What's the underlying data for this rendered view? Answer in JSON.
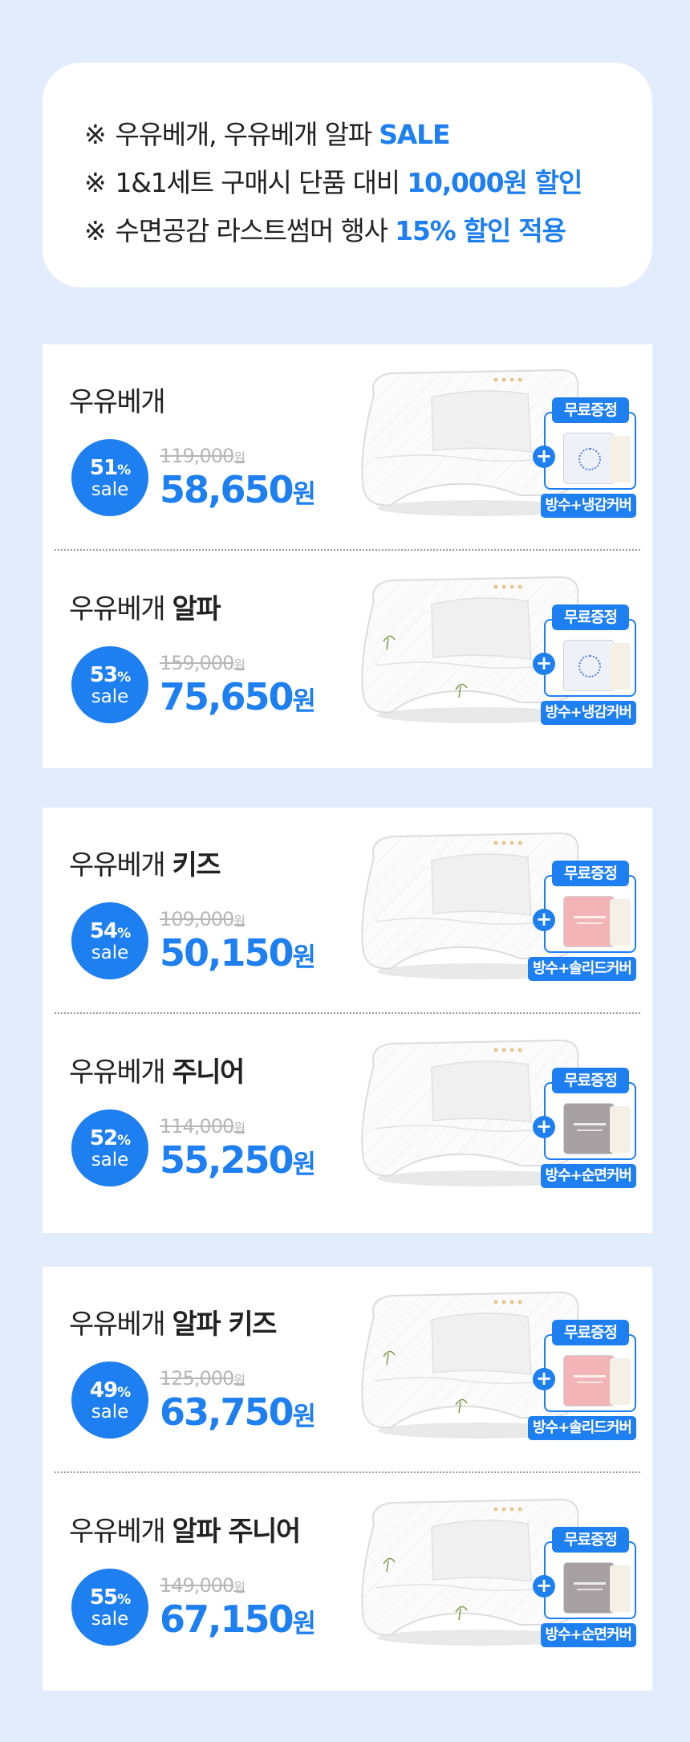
{
  "notice": {
    "mark": "※",
    "lines": [
      {
        "text": "우유베개, 우유베개 알파 ",
        "highlight": "SALE"
      },
      {
        "text": "1&1세트 구매시 단품 대비 ",
        "highlight": "10,000원 할인"
      },
      {
        "text": "수면공감 라스트썸머 행사 ",
        "highlight": "15% 할인 적용"
      }
    ]
  },
  "colors": {
    "accent": "#1e7ff0",
    "background": "#e3ecfd"
  },
  "common": {
    "pct_suffix": "%",
    "sale_label": "sale",
    "won": "원",
    "gift_tag": "무료증정",
    "plus": "+"
  },
  "products": [
    {
      "name": "우유베개",
      "name_bold": "",
      "discount": "51",
      "original": "119,000",
      "price": "58,650",
      "gift": "방수+냉감커버",
      "cover": "cool",
      "pillow_green": false
    },
    {
      "name": "우유베개 ",
      "name_bold": "알파",
      "discount": "53",
      "original": "159,000",
      "price": "75,650",
      "gift": "방수+냉감커버",
      "cover": "cool",
      "pillow_green": true
    },
    {
      "name": "우유베개 ",
      "name_bold": "키즈",
      "discount": "54",
      "original": "109,000",
      "price": "50,150",
      "gift": "방수+솔리드커버",
      "cover": "pink",
      "pillow_green": false
    },
    {
      "name": "우유베개 ",
      "name_bold": "주니어",
      "discount": "52",
      "original": "114,000",
      "price": "55,250",
      "gift": "방수+순면커버",
      "cover": "gray",
      "pillow_green": false
    },
    {
      "name": "우유베개 ",
      "name_bold": "알파 키즈",
      "discount": "49",
      "original": "125,000",
      "price": "63,750",
      "gift": "방수+솔리드커버",
      "cover": "pink",
      "pillow_green": true
    },
    {
      "name": "우유베개 ",
      "name_bold": "알파 주니어",
      "discount": "55",
      "original": "149,000",
      "price": "67,150",
      "gift": "방수+순면커버",
      "cover": "gray",
      "pillow_green": true
    }
  ]
}
